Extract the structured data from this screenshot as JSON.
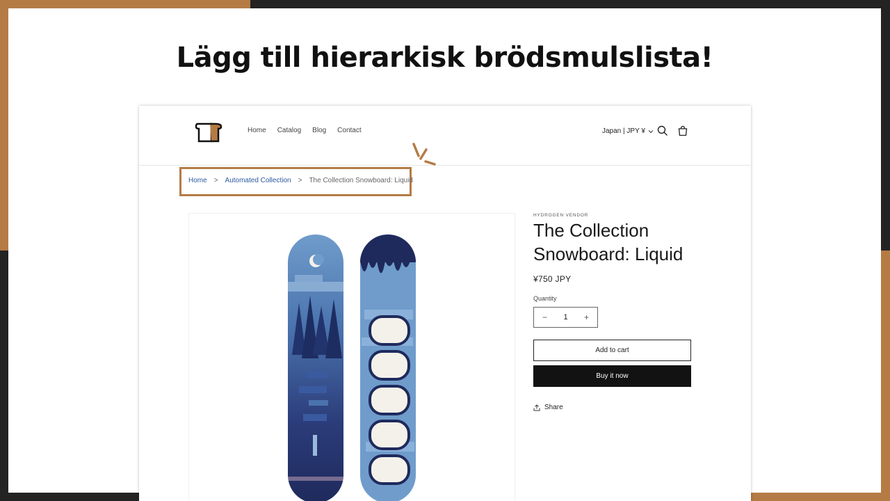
{
  "slide": {
    "headline": "Lägg till hierarkisk brödsmulslista!"
  },
  "store": {
    "nav": [
      "Home",
      "Catalog",
      "Blog",
      "Contact"
    ],
    "locale": "Japan | JPY ¥",
    "breadcrumb": {
      "home": "Home",
      "separator": ">",
      "collection": "Automated Collection",
      "current": "The Collection Snowboard: Liquid"
    },
    "product": {
      "vendor": "HYDROGEN VENDOR",
      "title": "The Collection Snowboard: Liquid",
      "price": "¥750 JPY",
      "quantity_label": "Quantity",
      "quantity_value": "1",
      "minus": "−",
      "plus": "+",
      "add_to_cart": "Add to cart",
      "buy_now": "Buy it now",
      "share": "Share"
    }
  },
  "colors": {
    "accent": "#b57b45",
    "dark_bg": "#232323",
    "link": "#2c5aa0",
    "board_dark": "#1f2a5c",
    "board_light": "#6f9ccb"
  }
}
